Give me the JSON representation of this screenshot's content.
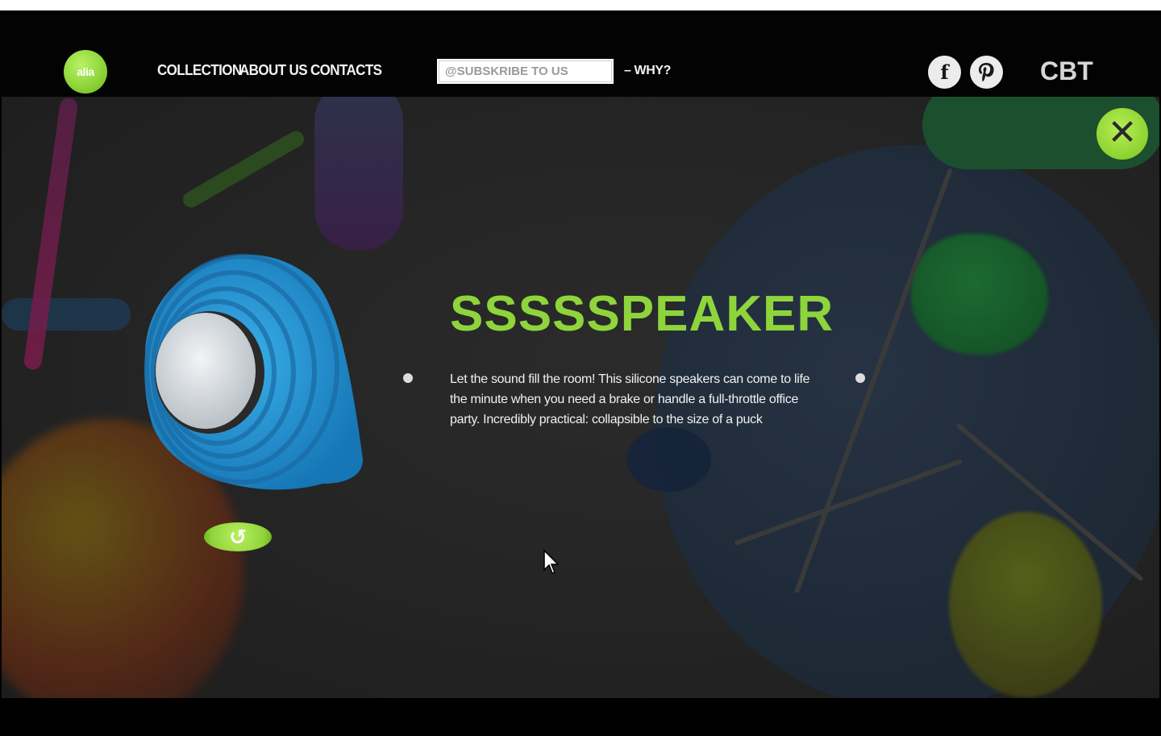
{
  "header": {
    "logo_text": "alia",
    "nav": [
      {
        "label": "COLLECTION"
      },
      {
        "label": "ABOUT US"
      },
      {
        "label": "CONTACTS"
      }
    ],
    "subscribe": {
      "placeholder": "@SUBSKRIBE TO US",
      "value": ""
    },
    "why_label": "– WHY?",
    "social": [
      {
        "icon": "facebook-icon",
        "glyph": "f"
      },
      {
        "icon": "pinterest-icon",
        "glyph": "P"
      }
    ],
    "brand_mark": "CBT"
  },
  "product": {
    "title": "SSSSSPEAKER",
    "description": "Let the sound fill the room! This silicone speakers can come to life the minute when you need a brake or handle a full-throttle office party. Incredibly practical: collapsible to the size of a puck"
  },
  "controls": {
    "close_glyph": "✕",
    "rotate_glyph": "↺"
  },
  "colors": {
    "accent_green": "#8ed53c",
    "speaker_blue": "#1f8fcf",
    "background": "#232323"
  }
}
